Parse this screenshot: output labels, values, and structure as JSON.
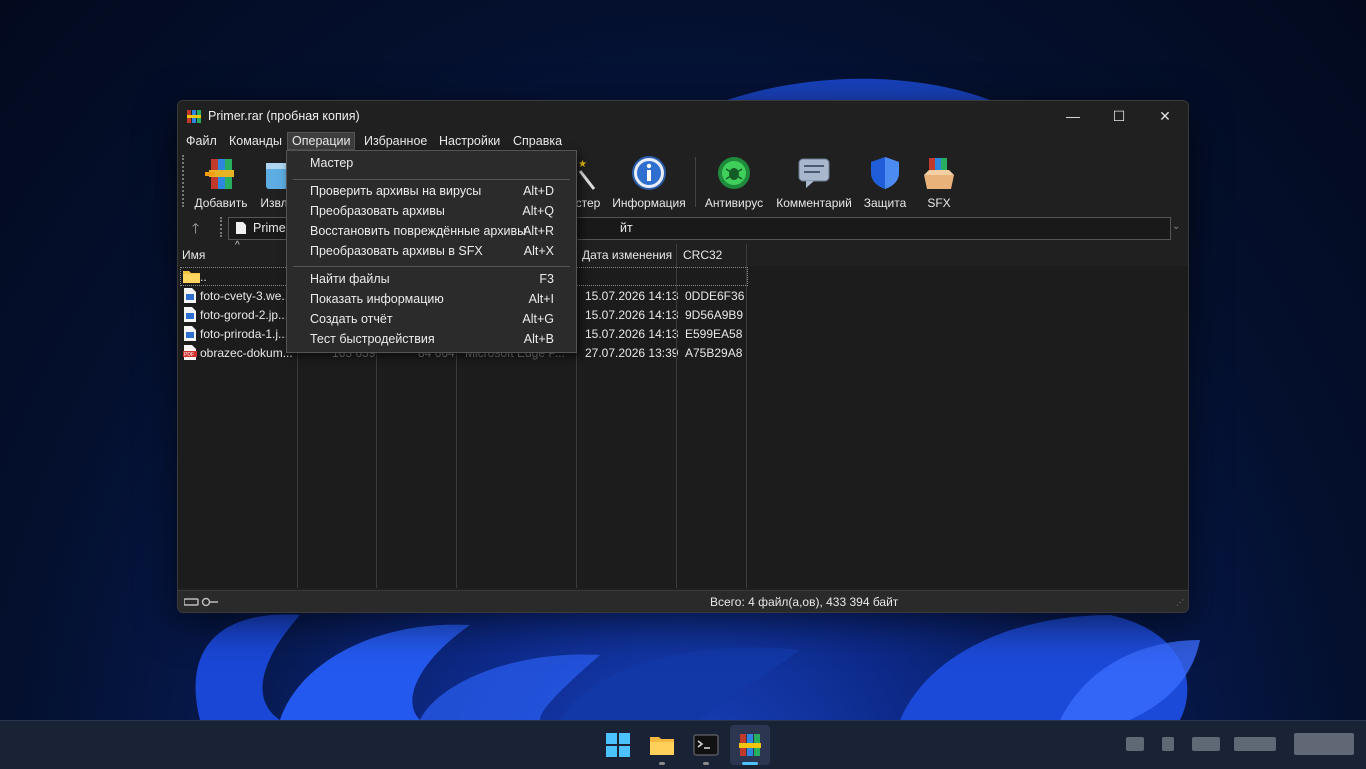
{
  "window": {
    "title": "Primer.rar (пробная копия)",
    "controls": {
      "minimize": "—",
      "maximize": "☐",
      "close": "✕"
    }
  },
  "menu": [
    "Файл",
    "Команды",
    "Операции",
    "Избранное",
    "Настройки",
    "Справка"
  ],
  "toolbar": {
    "buttons": [
      {
        "label": "Добавить",
        "icon": "add-archive-icon"
      },
      {
        "label": "Извл",
        "icon": "extract-icon"
      },
      {
        "label": "стер",
        "icon": "wizard-icon"
      },
      {
        "label": "Информация",
        "icon": "info-icon"
      },
      {
        "label": "Антивирус",
        "icon": "antivirus-icon"
      },
      {
        "label": "Комментарий",
        "icon": "comment-icon"
      },
      {
        "label": "Защита",
        "icon": "shield-icon"
      },
      {
        "label": "SFX",
        "icon": "sfx-icon"
      }
    ]
  },
  "address": {
    "text": "Primer",
    "tail": "йт"
  },
  "columns": {
    "name": "Имя",
    "modified": "Дата изменения",
    "crc": "CRC32",
    "sort_arrow": "^"
  },
  "files": [
    {
      "name": "..",
      "icon": "folder-icon",
      "modified": "",
      "crc": ""
    },
    {
      "name": "foto-cvety-3.we...",
      "icon": "image-file-icon",
      "modified": "15.07.2026 14:13",
      "crc": "0DDE6F36"
    },
    {
      "name": "foto-gorod-2.jp...",
      "icon": "image-file-icon",
      "modified": "15.07.2026 14:13",
      "crc": "9D56A9B9"
    },
    {
      "name": "foto-priroda-1.j...",
      "icon": "image-file-icon",
      "modified": "15.07.2026 14:13",
      "crc": "E599EA58"
    },
    {
      "name": "obrazec-dokum...",
      "icon": "pdf-file-icon",
      "modified": "27.07.2026 13:39",
      "crc": "A75B29A8",
      "size": "165 659",
      "packed": "84 664",
      "type": "Microsoft Edge P..."
    }
  ],
  "status": {
    "text": "Всего: 4 файл(а,ов), 433 394 байт"
  },
  "dropdown": {
    "groups": [
      [
        {
          "label": "Мастер",
          "key": ""
        }
      ],
      [
        {
          "label": "Проверить архивы на вирусы",
          "key": "Alt+D"
        },
        {
          "label": "Преобразовать архивы",
          "key": "Alt+Q"
        },
        {
          "label": "Восстановить повреждённые архивы",
          "key": "Alt+R"
        },
        {
          "label": "Преобразовать архивы в SFX",
          "key": "Alt+X"
        }
      ],
      [
        {
          "label": "Найти файлы",
          "key": "F3"
        },
        {
          "label": "Показать информацию",
          "key": "Alt+I"
        },
        {
          "label": "Создать отчёт",
          "key": "Alt+G"
        },
        {
          "label": "Тест быстродействия",
          "key": "Alt+B"
        }
      ]
    ]
  },
  "taskbar": {
    "apps": [
      "start-icon",
      "file-explorer-icon",
      "terminal-icon",
      "winrar-icon"
    ]
  }
}
